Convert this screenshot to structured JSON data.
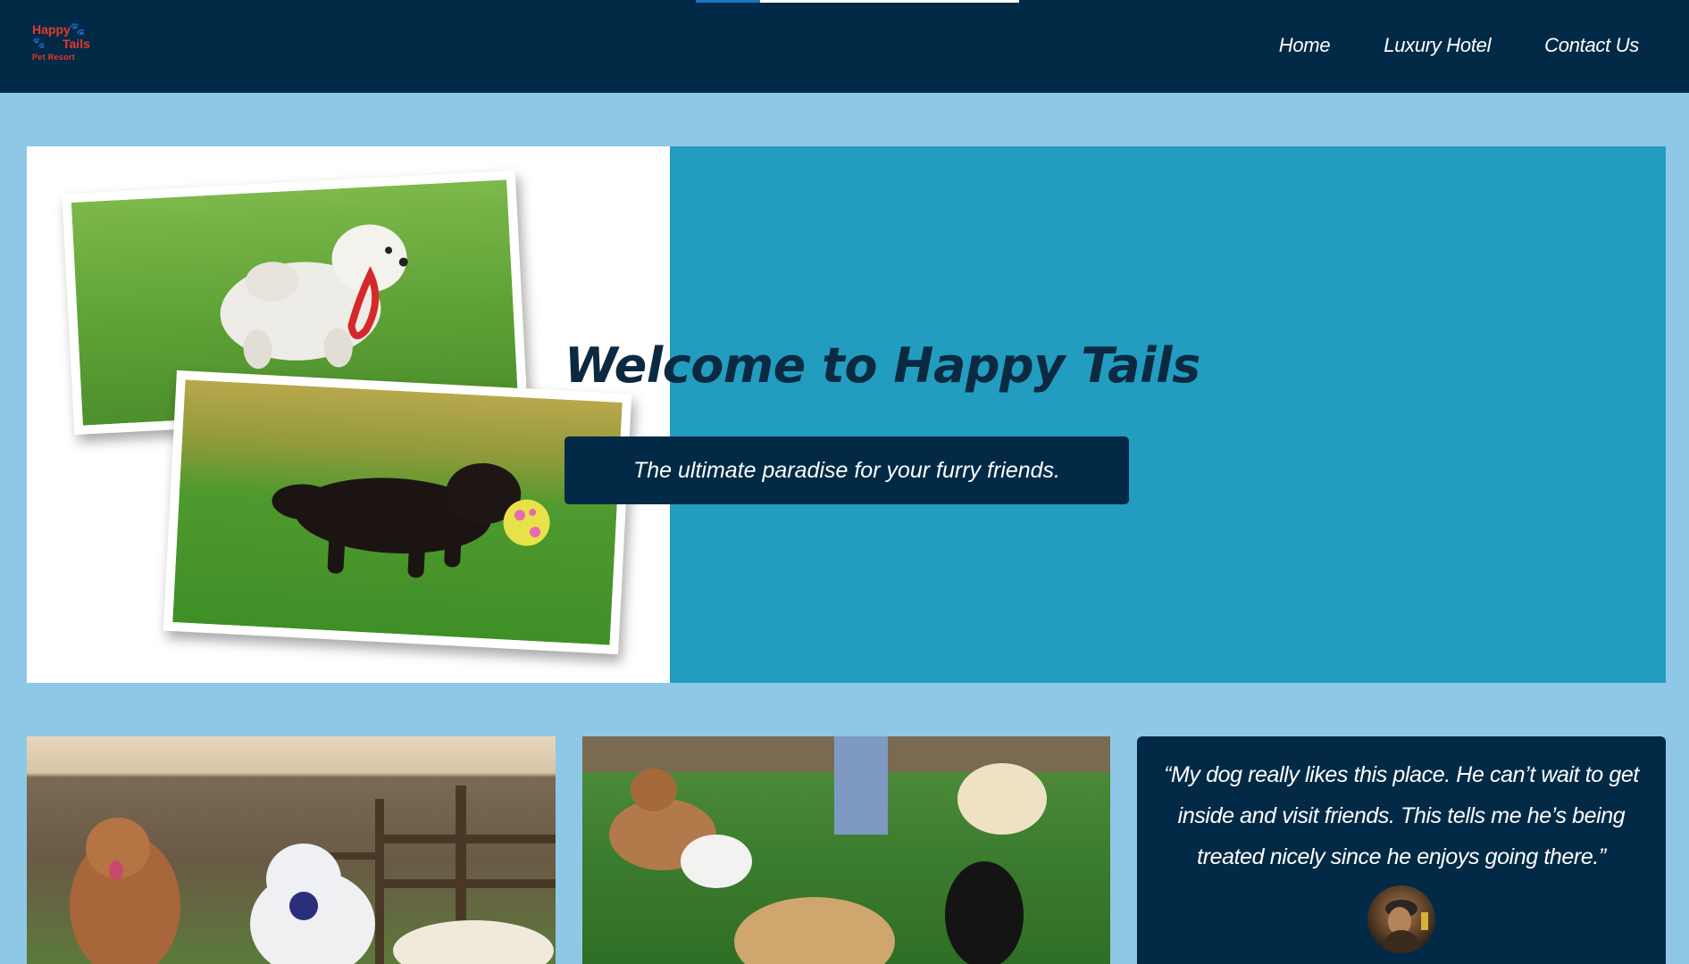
{
  "header": {
    "logo": {
      "line1": "Happy",
      "line2": "Tails",
      "line3": "Pet Resort"
    },
    "nav": [
      {
        "label": "Home"
      },
      {
        "label": "Luxury Hotel"
      },
      {
        "label": "Contact Us"
      }
    ],
    "scroll_progress": 0.2
  },
  "hero": {
    "title": "Welcome to Happy Tails",
    "subtitle": "The ultimate paradise for your furry friends."
  },
  "testimonial": {
    "quote": "“My dog really likes this place. He can’t wait to get inside and visit friends. This tells me he’s being treated nicely since he enjoys going there.”"
  },
  "colors": {
    "header_bg": "#022a46",
    "page_bg": "#8ec8e6",
    "hero_panel": "#229dc0",
    "progress_accent": "#1e73be",
    "logo_red": "#e6392a",
    "logo_paw": "#f2b01e"
  }
}
